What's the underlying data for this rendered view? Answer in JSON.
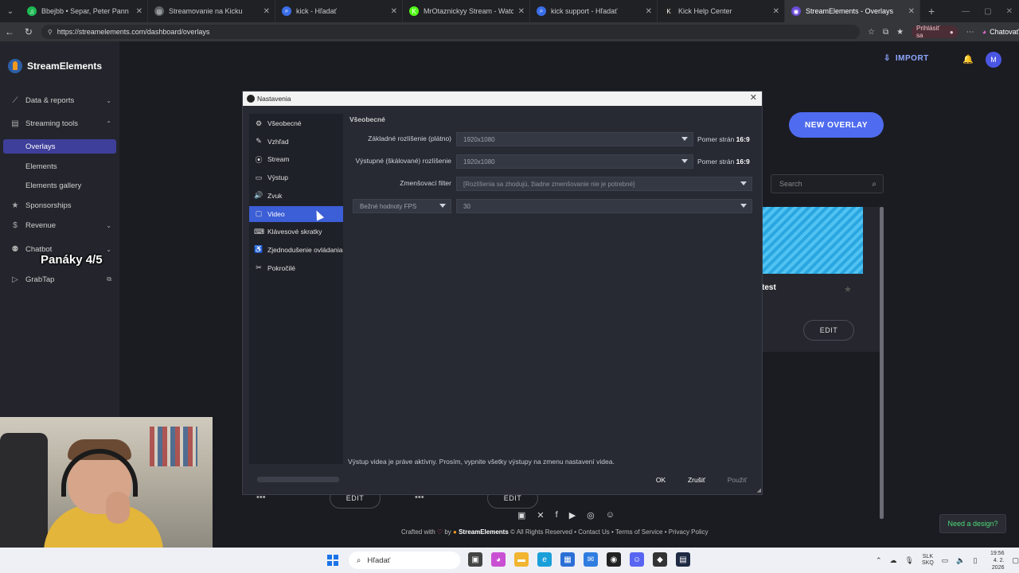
{
  "browser": {
    "tabs": [
      {
        "title": "Bbejbb • Separ, Peter Pann",
        "color": "#1db954",
        "glyph": "♫"
      },
      {
        "title": "Streamovanie na Kicku",
        "color": "#5f6368",
        "glyph": "◎"
      },
      {
        "title": "kick - Hľadať",
        "color": "#3a6ee8",
        "glyph": "⌕"
      },
      {
        "title": "MrOtaznickyy Stream - Watch Live",
        "color": "#53fc18",
        "glyph": "K"
      },
      {
        "title": "kick support - Hľadať",
        "color": "#3a6ee8",
        "glyph": "⌕"
      },
      {
        "title": "Kick Help Center",
        "color": "#222222",
        "glyph": "K"
      },
      {
        "title": "StreamElements - Overlays",
        "color": "#6b4bd8",
        "glyph": "◉"
      }
    ],
    "url": "https://streamelements.com/dashboard/overlays",
    "signin_label": "Prihlásiť sa",
    "chat_label": "Chatovať"
  },
  "site": {
    "brand": "StreamElements",
    "nav": {
      "data_reports": "Data & reports",
      "streaming_tools": "Streaming tools",
      "overlays": "Overlays",
      "elements": "Elements",
      "elements_gallery": "Elements gallery",
      "sponsorships": "Sponsorships",
      "revenue": "Revenue",
      "chatbot": "Chatbot",
      "grabtap": "GrabTap"
    },
    "import_label": "IMPORT",
    "avatar_letter": "M",
    "new_overlay_label": "NEW OVERLAY",
    "search_placeholder": "Search",
    "card_title": "test",
    "edit_label": "EDIT",
    "footer": {
      "crafted": "Crafted with",
      "by": "by",
      "brand": "StreamElements",
      "rights": "© All Rights Reserved",
      "contact": "Contact Us",
      "terms": "Terms of Service",
      "privacy": "Privacy Policy"
    },
    "need_design": "Need a design?"
  },
  "stream_overlay_text": "Panáky 4/5",
  "dialog": {
    "title": "Nastavenia",
    "nav": [
      {
        "label": "Všeobecné",
        "icon": "gear-icon",
        "glyph": "⚙"
      },
      {
        "label": "Vzhľad",
        "icon": "brush-icon",
        "glyph": "✎"
      },
      {
        "label": "Stream",
        "icon": "broadcast-icon",
        "glyph": "⦿"
      },
      {
        "label": "Výstup",
        "icon": "output-icon",
        "glyph": "▭"
      },
      {
        "label": "Zvuk",
        "icon": "speaker-icon",
        "glyph": "🔊"
      },
      {
        "label": "Video",
        "icon": "monitor-icon",
        "glyph": "▢"
      },
      {
        "label": "Klávesové skratky",
        "icon": "keyboard-icon",
        "glyph": "⌨"
      },
      {
        "label": "Zjednodušenie ovládania",
        "icon": "accessibility-icon",
        "glyph": "♿"
      },
      {
        "label": "Pokročilé",
        "icon": "tools-icon",
        "glyph": "✂"
      }
    ],
    "selected_index": 5,
    "group_title": "Všeobecné",
    "base_res_label": "Základné rozlíšenie (plátno)",
    "base_res_value": "1920x1080",
    "output_res_label": "Výstupné (škálované) rozlíšenie",
    "output_res_value": "1920x1080",
    "aspect_prefix": "Pomer strán",
    "aspect_value": "16:9",
    "filter_label": "Zmenšovací filter",
    "filter_value": "[Rozlíšenia sa zhodujú, žiadne zmenšovanie nie je potrebné]",
    "fps_type": "Bežné hodnoty FPS",
    "fps_value": "30",
    "warning": "Výstup videa je práve aktívny. Prosím, vypnite všetky výstupy na zmenu nastavení videa.",
    "ok": "OK",
    "cancel": "Zrušiť",
    "apply": "Použiť"
  },
  "taskbar": {
    "search": "Hľadať",
    "lang_top": "SLK",
    "lang_bottom": "SKQ",
    "time": "19:56",
    "date": "4. 2. 2026"
  }
}
